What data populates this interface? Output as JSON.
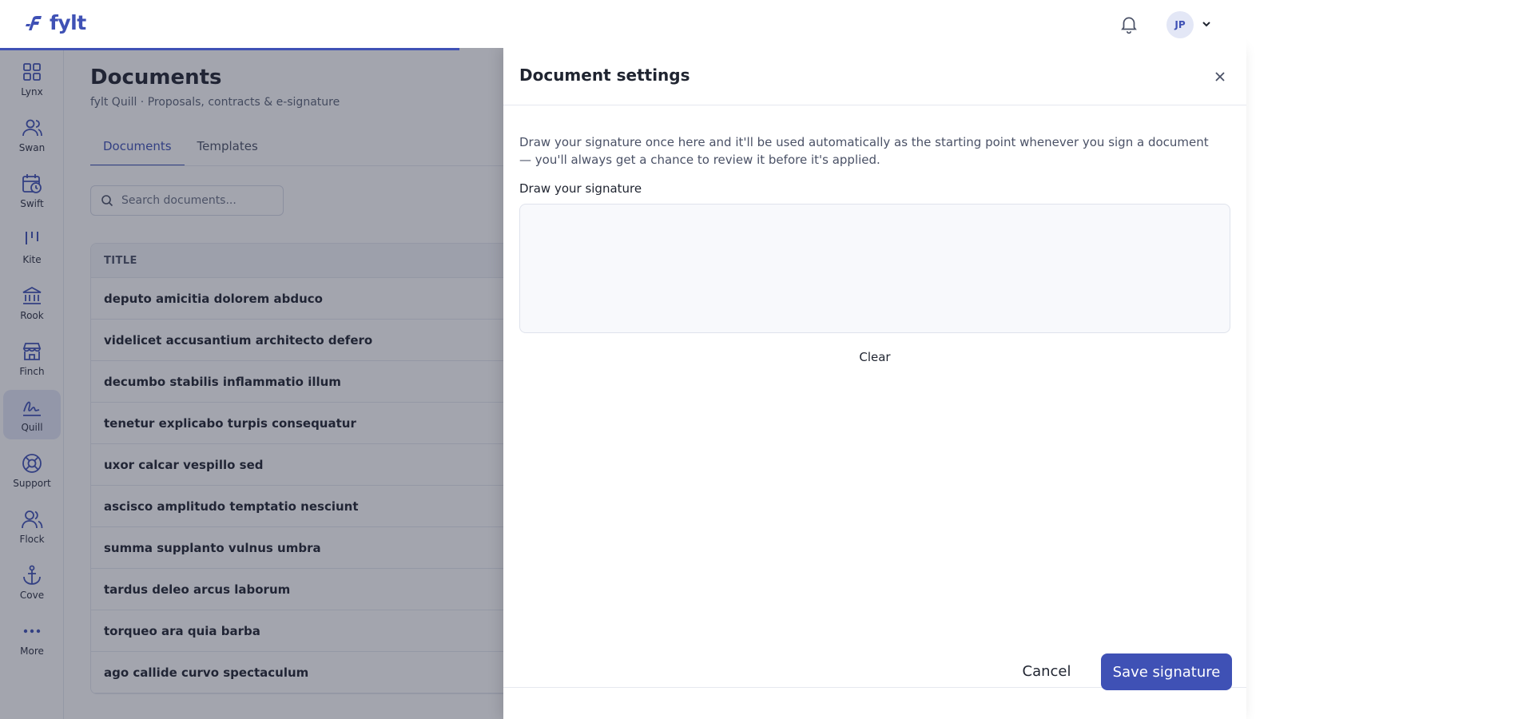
{
  "brand": {
    "name": "fylt"
  },
  "header": {
    "avatar_initials": "JP"
  },
  "sidebar": {
    "items": [
      {
        "label": "Lynx",
        "icon": "grid-icon"
      },
      {
        "label": "Swan",
        "icon": "users-icon"
      },
      {
        "label": "Swift",
        "icon": "calendar-clock-icon"
      },
      {
        "label": "Kite",
        "icon": "bars-icon"
      },
      {
        "label": "Rook",
        "icon": "bank-icon"
      },
      {
        "label": "Finch",
        "icon": "store-icon"
      },
      {
        "label": "Quill",
        "icon": "signature-icon"
      },
      {
        "label": "Support",
        "icon": "lifebuoy-icon"
      },
      {
        "label": "Flock",
        "icon": "people-icon"
      },
      {
        "label": "Cove",
        "icon": "anchor-icon"
      },
      {
        "label": "More",
        "icon": "more-dots-icon"
      }
    ],
    "active": "Quill"
  },
  "main": {
    "title": "Documents",
    "subtitle": "fylt Quill · Proposals, contracts & e-signature",
    "tabs": [
      {
        "label": "Documents"
      },
      {
        "label": "Templates"
      }
    ],
    "active_tab": "Documents",
    "search_placeholder": "Search documents...",
    "table": {
      "columns": [
        "TITLE"
      ],
      "rows": [
        "deputo amicitia dolorem abduco",
        "videlicet accusantium architecto defero",
        "decumbo stabilis inflammatio illum",
        "tenetur explicabo turpis consequatur",
        "uxor calcar vespillo sed",
        "ascisco amplitudo temptatio nesciunt",
        "summa supplanto vulnus umbra",
        "tardus deleo arcus laborum",
        "torqueo ara quia barba",
        "ago callide curvo spectaculum"
      ]
    }
  },
  "dialog": {
    "title": "Document settings",
    "description": "Draw your signature once here and it'll be used automatically as the starting point whenever you sign a document — you'll always get a chance to review it before it's applied.",
    "signature_label": "Draw your signature",
    "clear_label": "Clear",
    "cancel_label": "Cancel",
    "save_label": "Save signature"
  },
  "colors": {
    "accent": "#3f51b5",
    "active_nav_bg": "#e3e7f6",
    "overlay": "rgba(35,40,62,0.42)"
  }
}
